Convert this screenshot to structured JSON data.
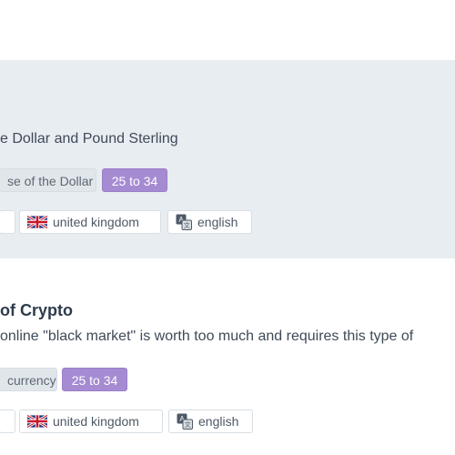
{
  "cards": [
    {
      "summary": "e Dollar and Pound Sterling",
      "tags": [
        "se of the Dollar"
      ],
      "age_range": "25 to 34",
      "country": "united kingdom",
      "language": "english",
      "country_icon": "uk-flag-icon",
      "language_icon": "translate-icon"
    },
    {
      "title": "of Crypto",
      "summary": "online \"black market\" is worth too much and requires this type of",
      "tags": [
        "currency"
      ],
      "age_range": "25 to 34",
      "country": "united kingdom",
      "language": "english",
      "country_icon": "uk-flag-icon",
      "language_icon": "translate-icon"
    }
  ],
  "colors": {
    "highlight_background": "#e8edf1",
    "age_badge": "#a58bd1",
    "text": "#3f4a58"
  }
}
